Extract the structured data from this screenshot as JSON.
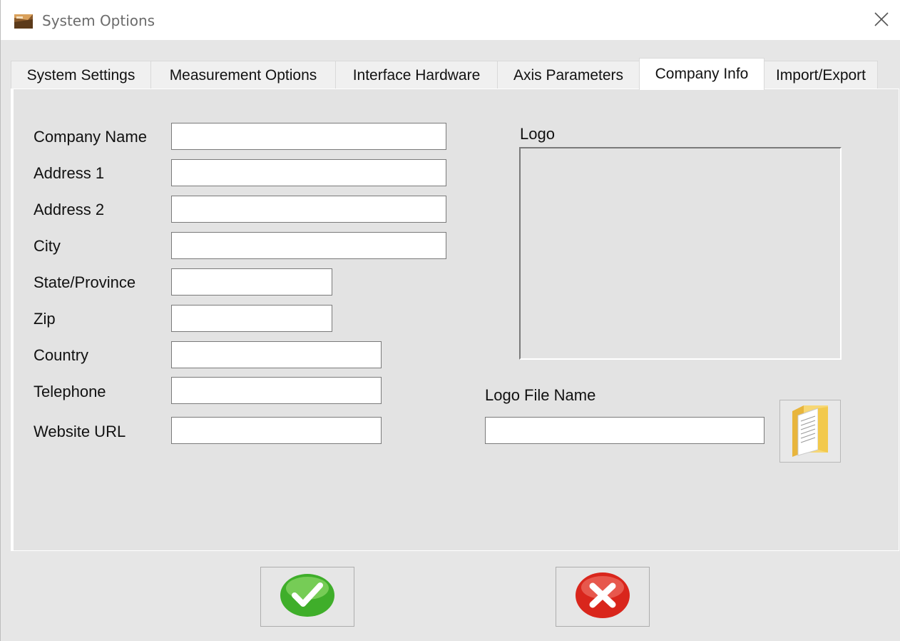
{
  "window": {
    "title": "System Options"
  },
  "tabs": [
    {
      "label": "System Settings"
    },
    {
      "label": "Measurement Options"
    },
    {
      "label": "Interface Hardware"
    },
    {
      "label": "Axis Parameters"
    },
    {
      "label": "Company Info",
      "active": true
    },
    {
      "label": "Import/Export"
    }
  ],
  "company_info": {
    "fields": [
      {
        "label": "Company Name",
        "value": ""
      },
      {
        "label": "Address 1",
        "value": ""
      },
      {
        "label": "Address 2",
        "value": ""
      },
      {
        "label": "City",
        "value": ""
      },
      {
        "label": "State/Province",
        "value": ""
      },
      {
        "label": "Zip",
        "value": ""
      },
      {
        "label": "Country",
        "value": ""
      },
      {
        "label": "Telephone",
        "value": ""
      },
      {
        "label": "Website URL",
        "value": ""
      }
    ],
    "logo_label": "Logo",
    "logo_file_label": "Logo File Name",
    "logo_file_value": ""
  },
  "icons": {
    "app": "app-icon",
    "close": "close-icon",
    "browse": "folder-icon",
    "ok": "checkmark-icon",
    "cancel": "cancel-x-icon"
  },
  "colors": {
    "ok_green": "#3fae2a",
    "cancel_red": "#d9261c",
    "folder_yellow": "#f2c94c"
  }
}
